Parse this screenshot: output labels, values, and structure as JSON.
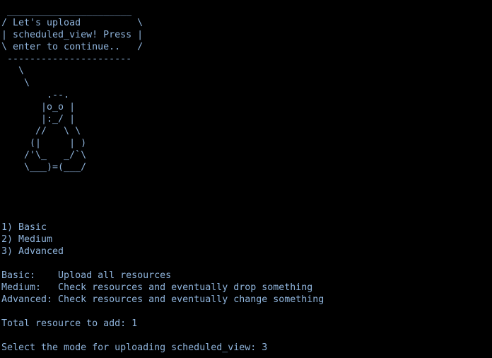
{
  "terminal": {
    "banner_lines": [
      " ______________________ ",
      "/ Let's upload          \\",
      "| scheduled_view! Press |",
      "\\ enter to continue..   /",
      " ---------------------- ",
      "   \\",
      "    \\",
      "        .--.",
      "       |o_o |",
      "       |:_/ |",
      "      //   \\ \\",
      "     (|     | )",
      "    /'\\_   _/`\\",
      "    \\___)=(___/"
    ],
    "menu_lines": [
      "1) Basic",
      "2) Medium",
      "3) Advanced"
    ],
    "description_lines": [
      "Basic:    Upload all resources",
      "Medium:   Check resources and eventually drop something",
      "Advanced: Check resources and eventually change something"
    ],
    "total_line": "Total resource to add: 1",
    "prompt_text": "Select the mode for uploading scheduled_view: ",
    "prompt_input": "3"
  }
}
